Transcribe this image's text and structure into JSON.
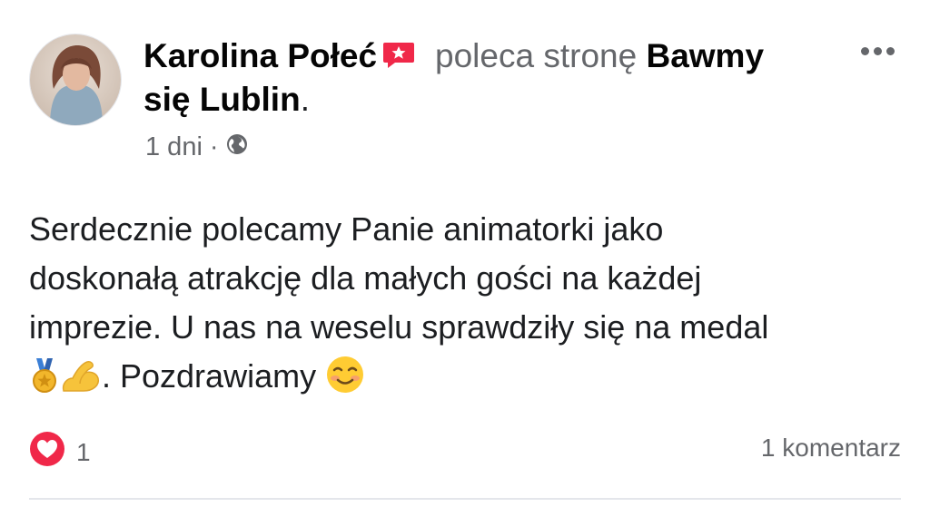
{
  "post": {
    "author": "Karolina Połeć",
    "action_text": "poleca stronę",
    "page_name_part1": "Bawmy",
    "page_name_part2": "się Lublin",
    "period": ".",
    "time": "1 dni",
    "separator": "·",
    "audience_icon": "globe-icon",
    "recommend_icon": "recommend-badge-icon",
    "body_line1": "Serdecznie polecamy Panie animatorki jako",
    "body_line2": "doskonałą atrakcję dla małych gości na każdej",
    "body_line3": "imprezie.  U nas na weselu sprawdziły się na medal",
    "body_line4_text": ". Pozdrawiamy",
    "emojis": [
      "medal-emoji",
      "flexed-biceps-emoji",
      "smiling-face-emoji"
    ]
  },
  "footer": {
    "reaction_icon": "love-reaction-icon",
    "reaction_count": "1",
    "comments": "1 komentarz"
  },
  "colors": {
    "text": "#1c1e21",
    "secondary": "#65676b",
    "recommend_badge": "#f02849",
    "love_reaction": "#f02849",
    "divider": "#e4e6eb"
  }
}
